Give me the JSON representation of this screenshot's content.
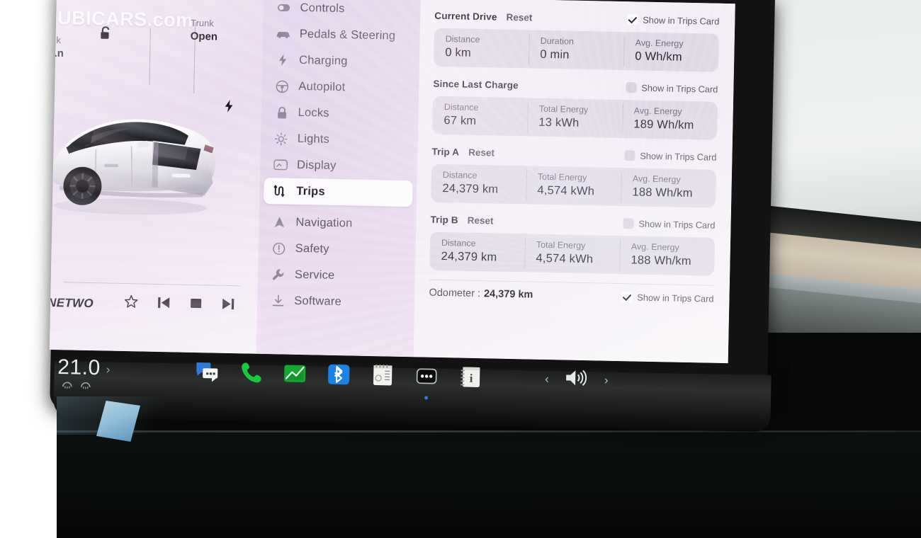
{
  "watermark": "DUBICARS.com",
  "car_panel": {
    "trunk": {
      "label": "Trunk",
      "state": "Open"
    },
    "frunk": {
      "label": "...k",
      "state": "...n"
    },
    "lock_icon": "unlock-icon",
    "charge_icon": "charge-bolt-icon"
  },
  "media": {
    "title": "NETWO",
    "favorite_icon": "star-icon",
    "previous_icon": "previous-track-icon",
    "stop_icon": "stop-icon",
    "next_icon": "next-track-icon"
  },
  "sidebar": {
    "items": [
      {
        "label": "Controls",
        "icon": "toggle-icon",
        "active": false
      },
      {
        "label": "Pedals & Steering",
        "icon": "car-icon",
        "active": false
      },
      {
        "label": "Charging",
        "icon": "bolt-icon",
        "active": false
      },
      {
        "label": "Autopilot",
        "icon": "steering-wheel-icon",
        "active": false
      },
      {
        "label": "Locks",
        "icon": "lock-icon",
        "active": false
      },
      {
        "label": "Lights",
        "icon": "sun-icon",
        "active": false
      },
      {
        "label": "Display",
        "icon": "display-icon",
        "active": false
      },
      {
        "label": "Trips",
        "icon": "trips-route-icon",
        "active": true
      },
      {
        "label": "Navigation",
        "icon": "navigation-arrow-icon",
        "active": false
      },
      {
        "label": "Safety",
        "icon": "alert-circle-icon",
        "active": false
      },
      {
        "label": "Service",
        "icon": "wrench-icon",
        "active": false
      },
      {
        "label": "Software",
        "icon": "download-icon",
        "active": false
      }
    ]
  },
  "trips": {
    "show_in_trips_card_label": "Show in Trips Card",
    "reset_label": "Reset",
    "sections": [
      {
        "title": "Current Drive",
        "has_reset": true,
        "show_in_card": true,
        "cells": [
          {
            "label": "Distance",
            "value": "0 km"
          },
          {
            "label": "Duration",
            "value": "0 min"
          },
          {
            "label": "Avg. Energy",
            "value": "0 Wh/km"
          }
        ]
      },
      {
        "title": "Since Last Charge",
        "has_reset": false,
        "show_in_card": false,
        "cells": [
          {
            "label": "Distance",
            "value": "67 km"
          },
          {
            "label": "Total Energy",
            "value": "13 kWh"
          },
          {
            "label": "Avg. Energy",
            "value": "189 Wh/km"
          }
        ]
      },
      {
        "title": "Trip A",
        "has_reset": true,
        "show_in_card": false,
        "cells": [
          {
            "label": "Distance",
            "value": "24,379 km"
          },
          {
            "label": "Total Energy",
            "value": "4,574 kWh"
          },
          {
            "label": "Avg. Energy",
            "value": "188 Wh/km"
          }
        ]
      },
      {
        "title": "Trip B",
        "has_reset": true,
        "show_in_card": false,
        "cells": [
          {
            "label": "Distance",
            "value": "24,379 km"
          },
          {
            "label": "Total Energy",
            "value": "4,574 kWh"
          },
          {
            "label": "Avg. Energy",
            "value": "188 Wh/km"
          }
        ]
      }
    ],
    "odometer": {
      "label": "Odometer :",
      "value": "24,379 km",
      "show_in_card": true,
      "show_in_card_label": "Show in Trips Card"
    }
  },
  "taskbar": {
    "temperature": "21.0",
    "temp_chevron": "›",
    "seat_left_icon": "seat-heater-icon",
    "seat_right_icon": "seat-heater-icon",
    "apps": [
      {
        "icon": "messages-icon",
        "has_indicator": false
      },
      {
        "icon": "phone-icon",
        "has_indicator": false
      },
      {
        "icon": "stocks-icon",
        "has_indicator": false
      },
      {
        "icon": "bluetooth-icon",
        "has_indicator": false
      },
      {
        "icon": "notes-icon",
        "has_indicator": false
      },
      {
        "icon": "more-dots-icon",
        "has_indicator": true
      },
      {
        "icon": "contacts-icon",
        "has_indicator": false
      }
    ],
    "volume_prev": "‹",
    "volume_icon": "volume-icon",
    "volume_next": "›"
  }
}
